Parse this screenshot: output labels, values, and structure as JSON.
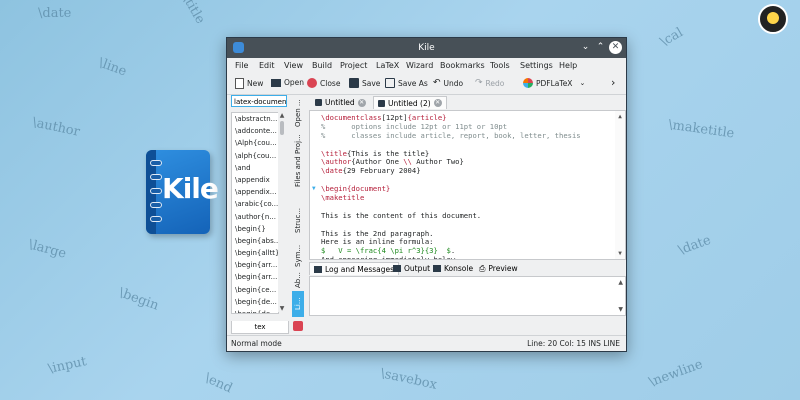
{
  "background": {
    "words": [
      "\\date",
      "\\title",
      "\\cal",
      "\\line",
      "\\author",
      "\\maketitle",
      "\\large",
      "\\date",
      "\\begin",
      "\\input",
      "\\end",
      "\\savebox",
      "\\newline"
    ]
  },
  "logo": {
    "text": "Kile"
  },
  "window": {
    "title": "Kile",
    "controls": {
      "minimize": "⌄",
      "maximize": "⌃",
      "close": "✕"
    }
  },
  "menu": [
    "File",
    "Edit",
    "View",
    "Build",
    "Project",
    "LaTeX",
    "Wizard",
    "Bookmarks",
    "Tools",
    "Settings",
    "Help"
  ],
  "toolbar": {
    "new": "New",
    "open": "Open",
    "close": "Close",
    "save": "Save",
    "save_as": "Save As",
    "undo": "Undo",
    "redo": "Redo",
    "build": "PDFLaTeX",
    "more": "›"
  },
  "left_panel": {
    "search_value": "latex-document",
    "items": [
      "\\abstractn...",
      "\\addconte...",
      "\\Alph{cou...",
      "\\alph{cou...",
      "\\and",
      "\\appendix",
      "\\appendix...",
      "\\arabic{co...",
      "\\author{n...",
      "\\begin{}",
      "\\begin{abs...",
      "\\begin{alltt}",
      "\\begin{arr...",
      "\\begin{arr...",
      "\\begin{ce...",
      "\\begin{de...",
      "\\begin{de..."
    ],
    "tab": "tex"
  },
  "side_tabs": [
    "Open ...",
    "Files and Proj...",
    "Struc...",
    "Sym...",
    "Ab...",
    "Li..."
  ],
  "editor_tabs": [
    {
      "label": "Untitled",
      "active": false
    },
    {
      "label": "Untitled (2)",
      "active": true
    }
  ],
  "code_lines": [
    [
      [
        "kw",
        "\\documentclass"
      ],
      [
        "txt",
        "[12pt]"
      ],
      [
        "arg",
        "{article}"
      ]
    ],
    [
      [
        "cm",
        "%      options include 12pt or 11pt or 10pt"
      ]
    ],
    [
      [
        "cm",
        "%      classes include article, report, book, letter, thesis"
      ]
    ],
    [
      [
        "txt",
        ""
      ]
    ],
    [
      [
        "kw",
        "\\title"
      ],
      [
        "txt",
        "{This is the title}"
      ]
    ],
    [
      [
        "kw",
        "\\author"
      ],
      [
        "txt",
        "{Author One "
      ],
      [
        "kw",
        "\\\\"
      ],
      [
        "txt",
        " Author Two}"
      ]
    ],
    [
      [
        "kw",
        "\\date"
      ],
      [
        "txt",
        "{29 February 2004}"
      ]
    ],
    [
      [
        "txt",
        ""
      ]
    ],
    [
      [
        "kw",
        "\\begin"
      ],
      [
        "arg",
        "{document}"
      ]
    ],
    [
      [
        "kw",
        "\\maketitle"
      ]
    ],
    [
      [
        "txt",
        ""
      ]
    ],
    [
      [
        "txt",
        "This is the content of this document."
      ]
    ],
    [
      [
        "txt",
        ""
      ]
    ],
    [
      [
        "txt",
        "This is the 2nd paragraph."
      ]
    ],
    [
      [
        "txt",
        "Here is an inline formula:"
      ]
    ],
    [
      [
        "math",
        "$   V = \\frac{4 \\pi r^3}{3}  $"
      ],
      [
        "txt",
        "."
      ]
    ],
    [
      [
        "txt",
        "And appearing immediately below"
      ]
    ]
  ],
  "bottom_tabs": [
    {
      "label": "Log and Messages",
      "active": true
    },
    {
      "label": "Output",
      "active": false
    },
    {
      "label": "Konsole",
      "active": false
    },
    {
      "label": "Preview",
      "active": false
    }
  ],
  "status": {
    "mode": "Normal mode",
    "position": "Line: 20 Col: 15  INS  LINE"
  }
}
